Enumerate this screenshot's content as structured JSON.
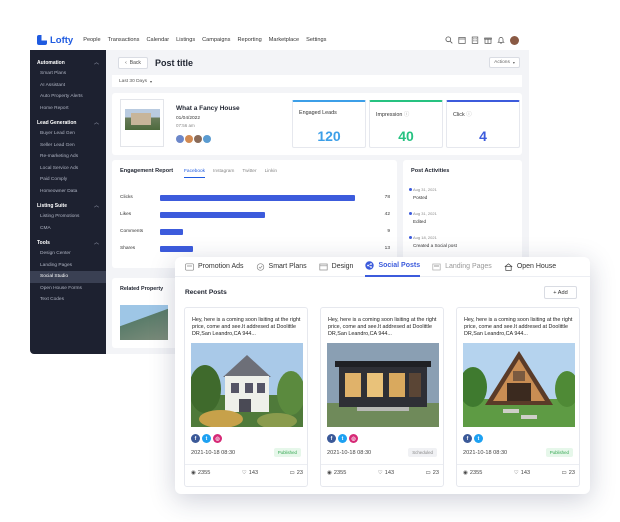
{
  "topbar": {
    "brand": "Lofty",
    "nav": [
      "People",
      "Transactions",
      "Calendar",
      "Listings",
      "Campaigns",
      "Reporting",
      "Marketplace",
      "Settings"
    ],
    "icons": [
      "search-icon",
      "calendar-icon",
      "building-icon",
      "gift-icon",
      "bell-icon",
      "user-avatar"
    ]
  },
  "sidebar": {
    "sections": [
      {
        "title": "Automation",
        "items": [
          "Smart Plans",
          "AI Assistant",
          "Auto Property Alerts",
          "Home Report"
        ]
      },
      {
        "title": "Lead Generation",
        "items": [
          "Buyer Lead Gen",
          "Seller Lead Gen",
          "Re-marketing Ads",
          "Local Service Ads",
          "Paid Comply",
          "Homeowner Data"
        ]
      },
      {
        "title": "Listing Suite",
        "items": [
          "Listing Promotions",
          "CMA"
        ]
      },
      {
        "title": "Tools",
        "items": [
          "Design Center",
          "Landing Pages",
          "Social Studio",
          "Open House Forms",
          "Text Codes"
        ]
      }
    ],
    "active": "Social Studio"
  },
  "page": {
    "back": "Back",
    "title": "Post title",
    "actions": "Actions",
    "range": "Last 30 Days"
  },
  "post": {
    "name": "What a Fancy House",
    "date": "01/04/2022",
    "time": "07:56 am"
  },
  "stats": [
    {
      "label": "Engaged Leads",
      "value": "120",
      "color": "#3c9fe8"
    },
    {
      "label": "Impression",
      "value": "40",
      "color": "#26c281"
    },
    {
      "label": "Click",
      "value": "4",
      "color": "#3c5bdc"
    }
  ],
  "engagement": {
    "title": "Engagement Report",
    "tabs": [
      "Facebook",
      "Instagram",
      "Twitter",
      "Linkin"
    ],
    "rows": [
      {
        "label": "Clicks",
        "value": 78
      },
      {
        "label": "Likes",
        "value": 42
      },
      {
        "label": "Comments",
        "value": 9
      },
      {
        "label": "Shares",
        "value": 13
      }
    ]
  },
  "activities": {
    "title": "Post Activities",
    "items": [
      {
        "date": "Aug 31, 2021",
        "text": "Posted"
      },
      {
        "date": "Aug 31, 2021",
        "text": "Edited"
      },
      {
        "date": "Aug 18, 2021",
        "text": "Created a Social post"
      }
    ]
  },
  "related": {
    "title": "Related Property"
  },
  "overlay": {
    "tabs": [
      "Promotion Ads",
      "Smart Plans",
      "Design",
      "Social Posts",
      "Landing Pages",
      "Open House"
    ],
    "active_tab": "Social Posts",
    "title": "Recent Posts",
    "add": "+ Add",
    "posts": [
      {
        "text": "Hey,  here is a coming soon lisiting at the right price, come and see.It addresed at Doolittle DR,San Leandro,CA 944...",
        "date": "2021-10-18 08:30",
        "status": "Published",
        "views": "2355",
        "likes": "143",
        "comments": "23",
        "networks": [
          "facebook",
          "twitter",
          "instagram"
        ]
      },
      {
        "text": "Hey,  here is a coming soon lisiting at the right price, come and see.It addresed at Doolittle DR,San Leandro,CA 944...",
        "date": "2021-10-18 08:30",
        "status": "Scheduled",
        "views": "2355",
        "likes": "143",
        "comments": "23",
        "networks": [
          "facebook",
          "twitter",
          "instagram"
        ]
      },
      {
        "text": "Hey,  here is a coming soon lisiting at the right price, come and see.It addresed at Doolittle DR,San Leandro,CA 944...",
        "date": "2021-10-18 08:30",
        "status": "Published",
        "views": "2355",
        "likes": "143",
        "comments": "23",
        "networks": [
          "facebook",
          "twitter"
        ]
      }
    ]
  }
}
